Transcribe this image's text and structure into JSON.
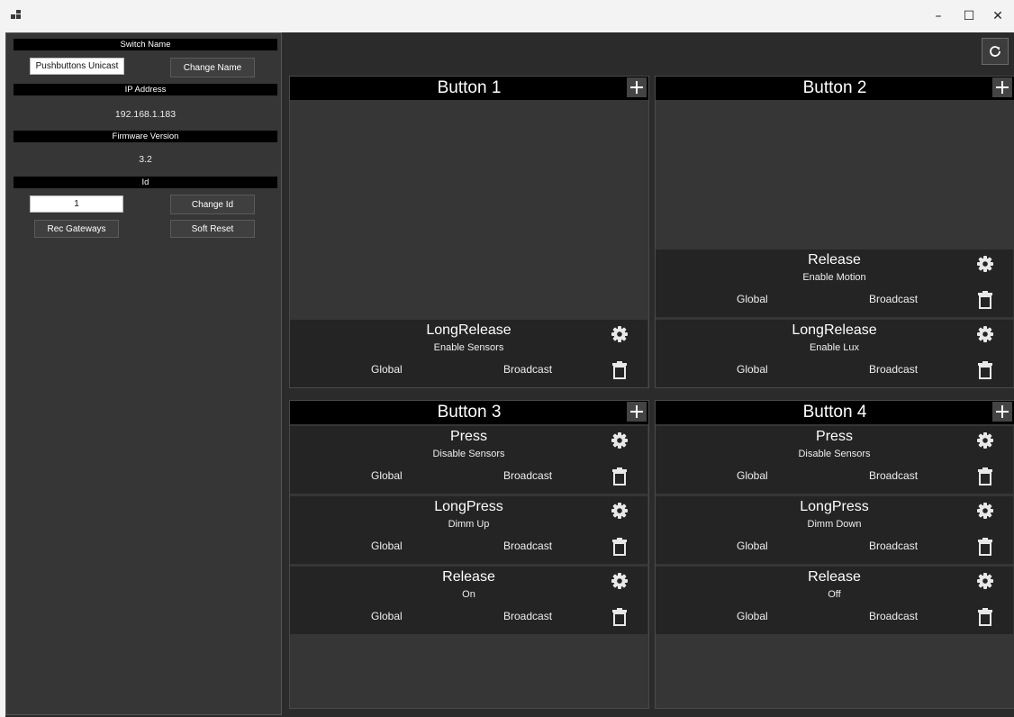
{
  "window": {
    "minimize_glyph": "–",
    "maximize_glyph": "☐",
    "close_glyph": "✕"
  },
  "sidebar": {
    "switch_name_header": "Switch Name",
    "switch_name_value": "Pushbuttons Unicast",
    "change_name_label": "Change Name",
    "ip_header": "IP Address",
    "ip_value": "192.168.1.183",
    "firmware_header": "Firmware Version",
    "firmware_value": "3.2",
    "id_header": "Id",
    "id_value": "1",
    "change_id_label": "Change Id",
    "rec_gateways_label": "Rec Gateways",
    "soft_reset_label": "Soft Reset"
  },
  "main": {
    "refresh_icon": "refresh-icon",
    "add_glyph": "+",
    "buttons": [
      {
        "title": "Button 1",
        "actions": [
          {
            "type": "LongRelease",
            "command": "Enable Sensors",
            "scope": "Global",
            "mode": "Broadcast"
          }
        ]
      },
      {
        "title": "Button 2",
        "actions": [
          {
            "type": "Release",
            "command": "Enable Motion",
            "scope": "Global",
            "mode": "Broadcast"
          },
          {
            "type": "LongRelease",
            "command": "Enable Lux",
            "scope": "Global",
            "mode": "Broadcast"
          }
        ]
      },
      {
        "title": "Button 3",
        "actions": [
          {
            "type": "Press",
            "command": "Disable Sensors",
            "scope": "Global",
            "mode": "Broadcast"
          },
          {
            "type": "LongPress",
            "command": "Dimm Up",
            "scope": "Global",
            "mode": "Broadcast"
          },
          {
            "type": "Release",
            "command": "On",
            "scope": "Global",
            "mode": "Broadcast"
          }
        ]
      },
      {
        "title": "Button 4",
        "actions": [
          {
            "type": "Press",
            "command": "Disable Sensors",
            "scope": "Global",
            "mode": "Broadcast"
          },
          {
            "type": "LongPress",
            "command": "Dimm Down",
            "scope": "Global",
            "mode": "Broadcast"
          },
          {
            "type": "Release",
            "command": "Off",
            "scope": "Global",
            "mode": "Broadcast"
          }
        ]
      }
    ]
  }
}
